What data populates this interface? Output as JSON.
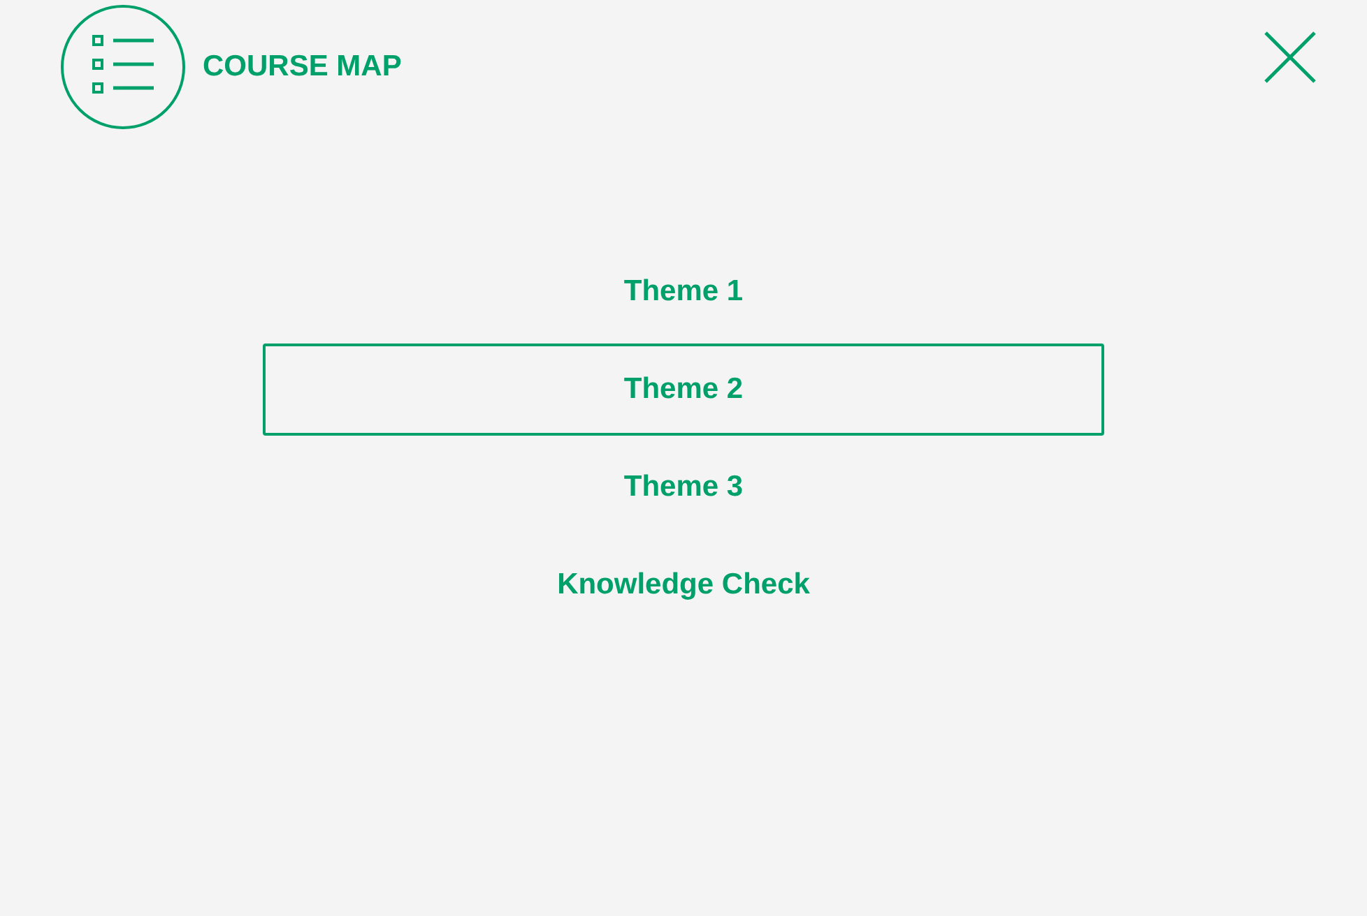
{
  "header": {
    "title": "COURSE MAP"
  },
  "menu": [
    {
      "label": "Theme 1",
      "selected": false
    },
    {
      "label": "Theme 2",
      "selected": true
    },
    {
      "label": "Theme 3",
      "selected": false
    },
    {
      "label": "Knowledge Check",
      "selected": false
    }
  ]
}
